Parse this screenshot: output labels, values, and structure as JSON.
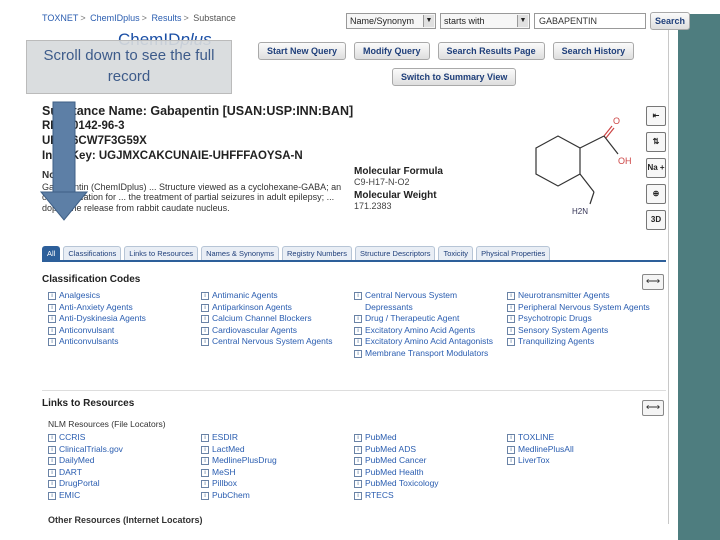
{
  "breadcrumb": [
    "TOXNET",
    "ChemIDplus",
    "Results",
    "Substance"
  ],
  "logo": {
    "main": "ChemID",
    "italic": "plus"
  },
  "search": {
    "field": "Name/Synonym",
    "mode": "starts with",
    "value": "GABAPENTIN",
    "button": "Search"
  },
  "nav_buttons": [
    "Start New Query",
    "Modify Query",
    "Search Results Page",
    "Search History"
  ],
  "summary_button": "Switch to Summary View",
  "callout": "Scroll down to see the full record",
  "substance": {
    "name": "Substance Name: Gabapentin [USAN:USP:INN:BAN]",
    "rn": "RN: 60142-96-3",
    "unii": "UNII: 6CW7F3G59X",
    "inchikey": "InChIKey: UGJMXCAKCUNAIE-UHFFFAOYSA-N",
    "note_label": "Note",
    "description": "Gabapentin (ChemIDplus) ... Structure viewed as a cyclohexane-GABA; an oral medication for ... the treatment of partial seizures in adult epilepsy; ... dopamine release from rabbit caudate nucleus."
  },
  "formula": {
    "label": "Molecular Formula",
    "value": "C9-H17-N-O2"
  },
  "weight": {
    "label": "Molecular Weight",
    "value": "171.2383"
  },
  "structure_atoms": {
    "o": "O",
    "oh": "OH",
    "n": "H2N"
  },
  "tools": [
    "exit-icon",
    "swap-icon",
    "Na+",
    "zoom-icon",
    "3D"
  ],
  "tools_text": {
    "na": "Na +",
    "threed": "3D"
  },
  "tabs": [
    "All",
    "Classifications",
    "Links to Resources",
    "Names & Synonyms",
    "Registry Numbers",
    "Structure Descriptors",
    "Toxicity",
    "Physical Properties"
  ],
  "classification": {
    "title": "Classification Codes",
    "columns": [
      [
        "Analgesics",
        "Anti-Anxiety Agents",
        "Anti-Dyskinesia Agents",
        "Anticonvulsant",
        "Anticonvulsants"
      ],
      [
        "Antimanic Agents",
        "Antiparkinson Agents",
        "Calcium Channel Blockers",
        "Cardiovascular Agents",
        "Central Nervous System Agents"
      ],
      [
        "Central Nervous System Depressants",
        "Drug / Therapeutic Agent",
        "Excitatory Amino Acid Agents",
        "Excitatory Amino Acid Antagonists",
        "Membrane Transport Modulators"
      ],
      [
        "Neurotransmitter Agents",
        "Peripheral Nervous System Agents",
        "Psychotropic Drugs",
        "Sensory System Agents",
        "Tranquilizing Agents"
      ]
    ]
  },
  "links": {
    "title": "Links to Resources",
    "nlm_label": "NLM Resources (File Locators)",
    "columns": [
      [
        "CCRIS",
        "ClinicalTrials.gov",
        "DailyMed",
        "DART",
        "DrugPortal",
        "EMIC"
      ],
      [
        "ESDIR",
        "LactMed",
        "MedlinePlusDrug",
        "MeSH",
        "Pillbox",
        "PubChem"
      ],
      [
        "PubMed",
        "PubMed ADS",
        "PubMed Cancer",
        "PubMed Health",
        "PubMed Toxicology",
        "RTECS"
      ],
      [
        "TOXLINE",
        "MedlinePlusAll",
        "LiverTox"
      ]
    ],
    "other_label": "Other Resources (Internet Locators)"
  }
}
